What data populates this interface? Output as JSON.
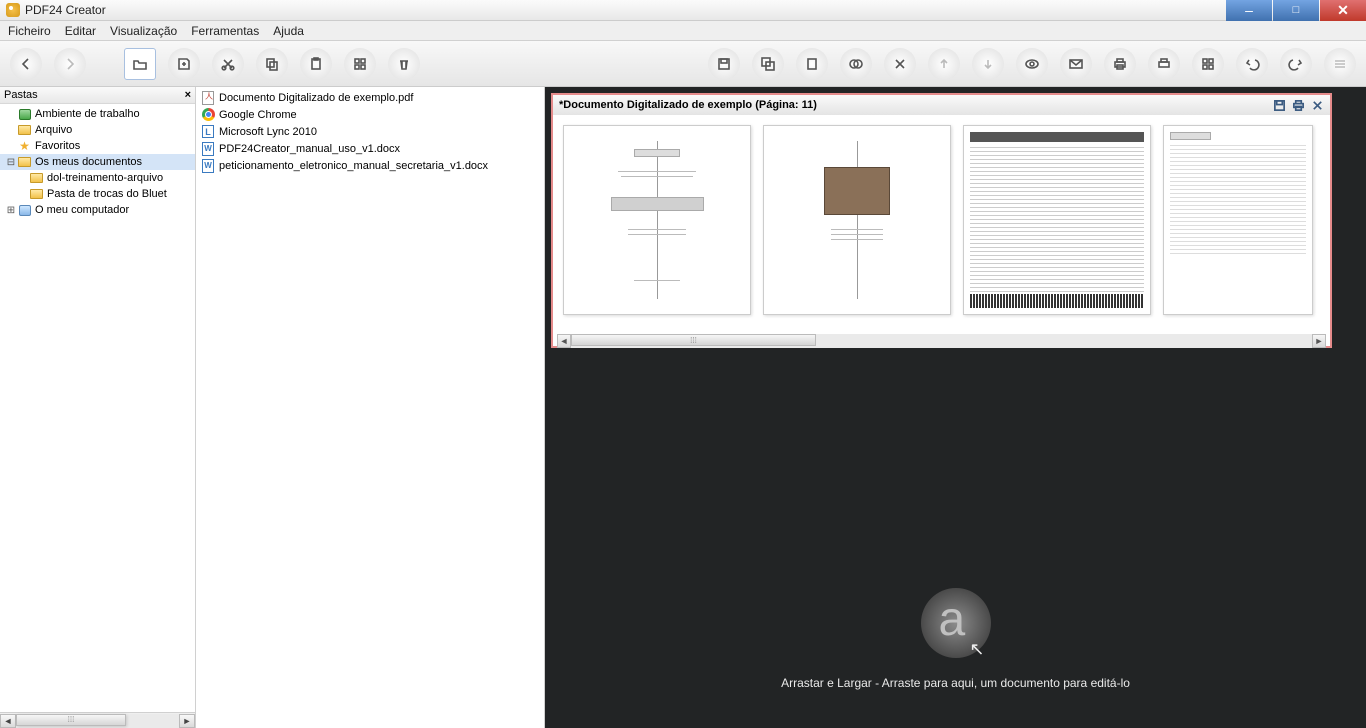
{
  "app": {
    "title": "PDF24 Creator"
  },
  "menu": {
    "file": "Ficheiro",
    "edit": "Editar",
    "view": "Visualização",
    "tools": "Ferramentas",
    "help": "Ajuda"
  },
  "sidebar": {
    "header": "Pastas",
    "nodes": {
      "desktop": "Ambiente de trabalho",
      "file": "Arquivo",
      "favorites": "Favoritos",
      "mydocs": "Os meus documentos",
      "sub1": "dol-treinamento-arquivo",
      "sub2": "Pasta de trocas do Bluet",
      "mypc": "O meu computador"
    }
  },
  "files": {
    "f0": "Documento Digitalizado de exemplo.pdf",
    "f1": "Google Chrome",
    "f2": "Microsoft Lync 2010",
    "f3": "PDF24Creator_manual_uso_v1.docx",
    "f4": "peticionamento_eletronico_manual_secretaria_v1.docx"
  },
  "preview": {
    "title": "*Documento Digitalizado de exemplo (Página: 11)"
  },
  "dropzone": {
    "text": "Arrastar e Largar - Arraste para aqui, um documento para editá-lo"
  }
}
